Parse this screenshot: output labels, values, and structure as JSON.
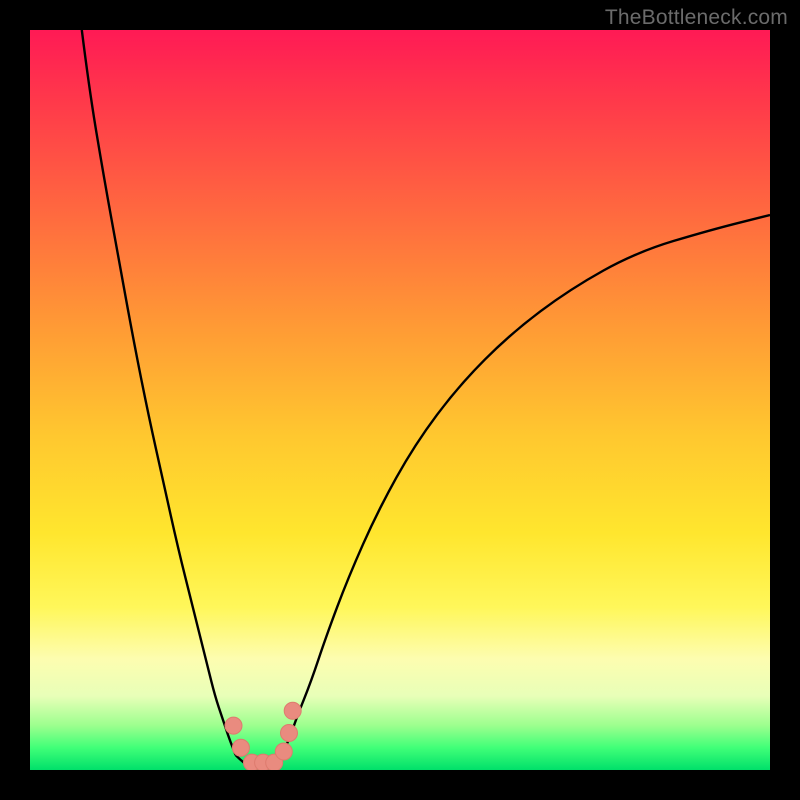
{
  "watermark": {
    "text": "TheBottleneck.com"
  },
  "colors": {
    "curve_stroke": "#000000",
    "marker_fill": "#e98b7f",
    "marker_stroke": "#de7b6e",
    "frame": "#000000"
  },
  "chart_data": {
    "type": "line",
    "title": "",
    "xlabel": "",
    "ylabel": "",
    "xlim": [
      0,
      100
    ],
    "ylim": [
      0,
      100
    ],
    "grid": false,
    "series": [
      {
        "name": "left-branch",
        "x": [
          7,
          8,
          10,
          12,
          14,
          16,
          18,
          20,
          22,
          24,
          25,
          26,
          27,
          27.8
        ],
        "values": [
          100,
          92,
          80,
          69,
          58,
          48,
          39,
          30,
          22,
          14,
          10,
          7,
          4,
          2
        ]
      },
      {
        "name": "right-branch",
        "x": [
          34,
          35,
          36,
          38,
          40,
          43,
          47,
          52,
          58,
          65,
          73,
          82,
          92,
          100
        ],
        "values": [
          2,
          4,
          7,
          12,
          18,
          26,
          35,
          44,
          52,
          59,
          65,
          70,
          73,
          75
        ]
      },
      {
        "name": "valley-floor",
        "x": [
          27.8,
          29,
          30,
          31,
          32,
          33,
          34
        ],
        "values": [
          2,
          0.8,
          0.5,
          0.5,
          0.5,
          0.8,
          2
        ]
      }
    ],
    "markers": {
      "name": "highlight-points",
      "x": [
        27.5,
        28.5,
        30,
        31.5,
        33,
        34.3,
        35,
        35.5
      ],
      "values": [
        6,
        3,
        1,
        1,
        1,
        2.5,
        5,
        8
      ]
    }
  }
}
